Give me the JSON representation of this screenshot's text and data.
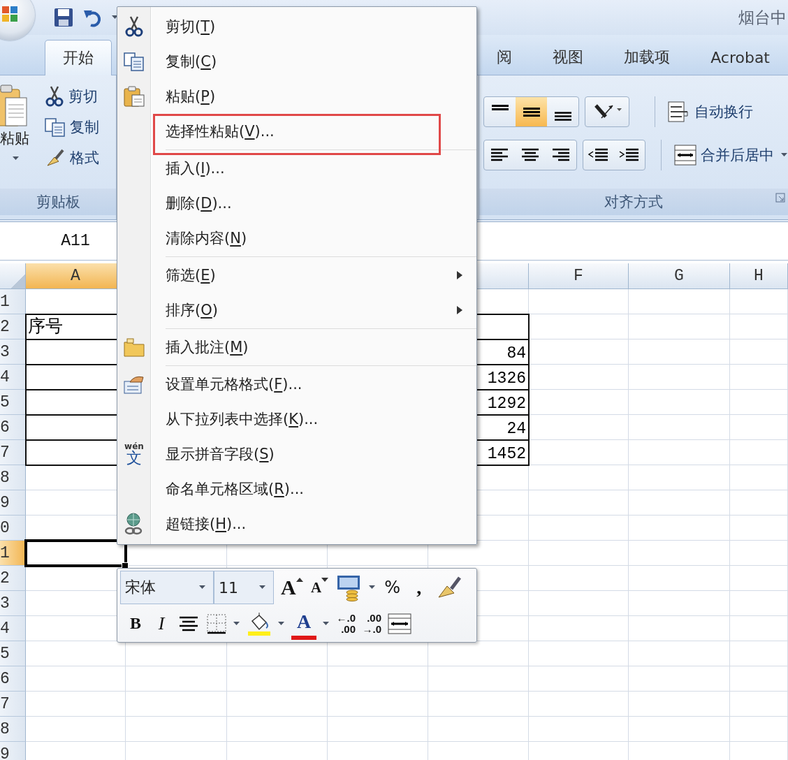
{
  "window": {
    "title": "烟台中"
  },
  "quick_access": [
    {
      "kind": "save"
    },
    {
      "kind": "undo"
    },
    {
      "kind": "customize"
    }
  ],
  "tabs": [
    {
      "label": "开始",
      "selected": true
    },
    {
      "label": "阅",
      "selected": false
    },
    {
      "label": "视图",
      "selected": false
    },
    {
      "label": "加载项",
      "selected": false
    },
    {
      "label": "Acrobat",
      "selected": false
    }
  ],
  "ribbon": {
    "clipboard": {
      "paste": "粘贴",
      "cut": "剪切",
      "copy": "复制",
      "format_painter": "格式",
      "label": "剪贴板"
    },
    "alignment": {
      "vertical": [
        {
          "kind": "top",
          "selected": false
        },
        {
          "kind": "middle",
          "selected": true
        },
        {
          "kind": "bottom",
          "selected": false
        }
      ],
      "wrap_text": "自动换行",
      "merge_center": "合并后居中",
      "label": "对齐方式"
    }
  },
  "name_box": "A11",
  "sheet": {
    "columns": [
      {
        "label": "A",
        "selected": true
      },
      {
        "label": "F",
        "selected": false
      },
      {
        "label": "G",
        "selected": false
      },
      {
        "label": "H",
        "selected": false
      }
    ],
    "rows": [
      {
        "label": "1",
        "selected": false,
        "bordered": false
      },
      {
        "label": "2",
        "selected": false,
        "bordered": true,
        "cells": [
          "序号"
        ]
      },
      {
        "label": "3",
        "selected": false,
        "bordered": true,
        "cells": [
          null,
          "84"
        ]
      },
      {
        "label": "4",
        "selected": false,
        "bordered": true,
        "cells": [
          null,
          "1326"
        ]
      },
      {
        "label": "5",
        "selected": false,
        "bordered": true,
        "cells": [
          null,
          "1292"
        ]
      },
      {
        "label": "6",
        "selected": false,
        "bordered": true,
        "cells": [
          null,
          "24"
        ]
      },
      {
        "label": "7",
        "selected": false,
        "bordered": true,
        "cells": [
          null,
          "1452"
        ]
      },
      {
        "label": "8",
        "selected": false,
        "bordered": false
      },
      {
        "label": "9",
        "selected": false,
        "bordered": false
      },
      {
        "label": "0",
        "selected": false,
        "bordered": false
      },
      {
        "label": "1",
        "selected": true,
        "bordered": false
      },
      {
        "label": "2",
        "selected": false,
        "bordered": false
      },
      {
        "label": "3",
        "selected": false,
        "bordered": false
      },
      {
        "label": "4",
        "selected": false,
        "bordered": false
      },
      {
        "label": "5",
        "selected": false,
        "bordered": false
      },
      {
        "label": "6",
        "selected": false,
        "bordered": false
      },
      {
        "label": "7",
        "selected": false,
        "bordered": false
      },
      {
        "label": "8",
        "selected": false,
        "bordered": false
      },
      {
        "label": "9",
        "selected": false,
        "bordered": false
      }
    ]
  },
  "context_menu": {
    "items": [
      {
        "kind": "cut",
        "label": "剪切(T)",
        "submenu": false,
        "highlighted": false
      },
      {
        "kind": "copy",
        "label": "复制(C)",
        "submenu": false,
        "highlighted": false
      },
      {
        "kind": "paste",
        "label": "粘贴(P)",
        "submenu": false,
        "highlighted": false
      },
      {
        "kind": "plain",
        "label": "选择性粘贴(V)...",
        "submenu": false,
        "highlighted": true
      },
      {
        "kind": "separator"
      },
      {
        "kind": "plain",
        "label": "插入(I)...",
        "submenu": false,
        "highlighted": false
      },
      {
        "kind": "plain",
        "label": "删除(D)...",
        "submenu": false,
        "highlighted": false
      },
      {
        "kind": "plain",
        "label": "清除内容(N)",
        "submenu": false,
        "highlighted": false
      },
      {
        "kind": "separator"
      },
      {
        "kind": "plain",
        "label": "筛选(E)",
        "submenu": true,
        "highlighted": false
      },
      {
        "kind": "plain",
        "label": "排序(O)",
        "submenu": true,
        "highlighted": false
      },
      {
        "kind": "separator"
      },
      {
        "kind": "comment",
        "label": "插入批注(M)",
        "submenu": false,
        "highlighted": false
      },
      {
        "kind": "separator"
      },
      {
        "kind": "format",
        "label": "设置单元格格式(F)...",
        "submenu": false,
        "highlighted": false
      },
      {
        "kind": "plain",
        "label": "从下拉列表中选择(K)...",
        "submenu": false,
        "highlighted": false
      },
      {
        "kind": "pinyin",
        "icon_text": [
          "wén",
          "文"
        ],
        "label": "显示拼音字段(S)",
        "submenu": false,
        "highlighted": false
      },
      {
        "kind": "plain",
        "label": "命名单元格区域(R)...",
        "submenu": false,
        "highlighted": false
      },
      {
        "kind": "link",
        "label": "超链接(H)...",
        "submenu": false,
        "highlighted": false
      }
    ]
  },
  "mini_toolbar": {
    "font": "宋体",
    "size": "11",
    "row_1": [
      {
        "kind": "grow-font",
        "text": "A"
      },
      {
        "kind": "shrink-font",
        "text": "A"
      },
      {
        "kind": "accounting"
      },
      {
        "kind": "dropdown"
      },
      {
        "kind": "percent",
        "text": "%"
      },
      {
        "kind": "comma",
        "text": ","
      },
      {
        "kind": "painter"
      }
    ],
    "row_2": [
      {
        "kind": "bold",
        "text": "B"
      },
      {
        "kind": "italic",
        "text": "I"
      },
      {
        "kind": "center"
      },
      {
        "kind": "borders"
      },
      {
        "kind": "dropdown"
      },
      {
        "kind": "fill-color"
      },
      {
        "kind": "dropdown"
      },
      {
        "kind": "font-color",
        "text": "A"
      },
      {
        "kind": "dropdown"
      },
      {
        "kind": "increase-decimal",
        "lines": [
          "←.0",
          ".00"
        ]
      },
      {
        "kind": "decrease-decimal",
        "lines": [
          ".00",
          "→.0"
        ]
      },
      {
        "kind": "merge"
      }
    ]
  }
}
